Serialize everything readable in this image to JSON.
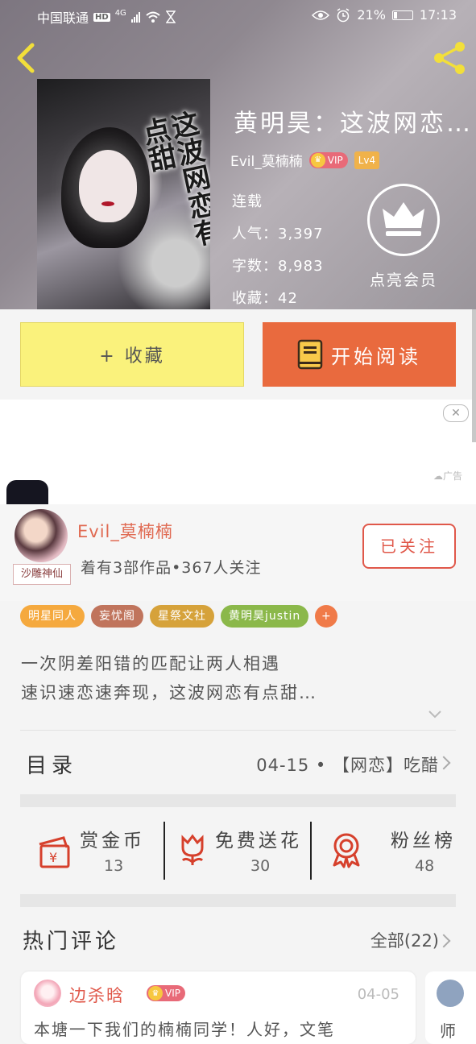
{
  "status_bar": {
    "carrier": "中国联通",
    "hd": "HD",
    "network": "4G",
    "battery": "21%",
    "battery_level": 0.21,
    "time": "17:13"
  },
  "book": {
    "title": "黄明昊：这波网恋…",
    "cover_title": "这波网恋有点甜",
    "author": "Evil_莫楠楠",
    "vip": "VIP",
    "level": "Lv4",
    "status": "连载",
    "popularity": "人气：3,397",
    "word_count": "字数：8,983",
    "favorites": "收藏：42",
    "member_label": "点亮会员"
  },
  "actions": {
    "favorite": "+ 收藏",
    "read": "开始阅读"
  },
  "ad": {
    "label": "广告",
    "close": "✕"
  },
  "author_card": {
    "name": "Evil_莫楠楠",
    "stats": "着有3部作品•367人关注",
    "avatar_tag": "沙雕神仙",
    "follow": "已关注"
  },
  "tags": [
    {
      "label": "明星同人",
      "color": "#f5a93e"
    },
    {
      "label": "妄忧阁",
      "color": "#c0745c"
    },
    {
      "label": "星祭文社",
      "color": "#d6a23a"
    },
    {
      "label": "黄明昊justin",
      "color": "#8bb84a"
    },
    {
      "label": "+",
      "color": "#f07a48"
    }
  ],
  "description": {
    "line1": "一次阴差阳错的匹配让两人相遇",
    "line2": "速识速恋速奔现，这波网恋有点甜…"
  },
  "toc": {
    "title": "目录",
    "latest": "04-15 • 【网恋】吃醋"
  },
  "stats": [
    {
      "label": "赏金币",
      "value": "13",
      "icon": "gift-card-icon"
    },
    {
      "label": "免费送花",
      "value": "30",
      "icon": "flower-icon"
    },
    {
      "label": "粉丝榜",
      "value": "48",
      "icon": "medal-icon"
    }
  ],
  "hot_comments": {
    "title": "热门评论",
    "all": "全部(22)",
    "items": [
      {
        "name": "边杀晗",
        "vip": "VIP",
        "date": "04-05",
        "text": "本塘一下我们的楠楠同学！人好，文笔"
      }
    ],
    "partial_text": "师"
  },
  "colors": {
    "accent_orange": "#e96a3e",
    "favorite_yellow": "#faf27c",
    "follow_red": "#e0584a"
  }
}
